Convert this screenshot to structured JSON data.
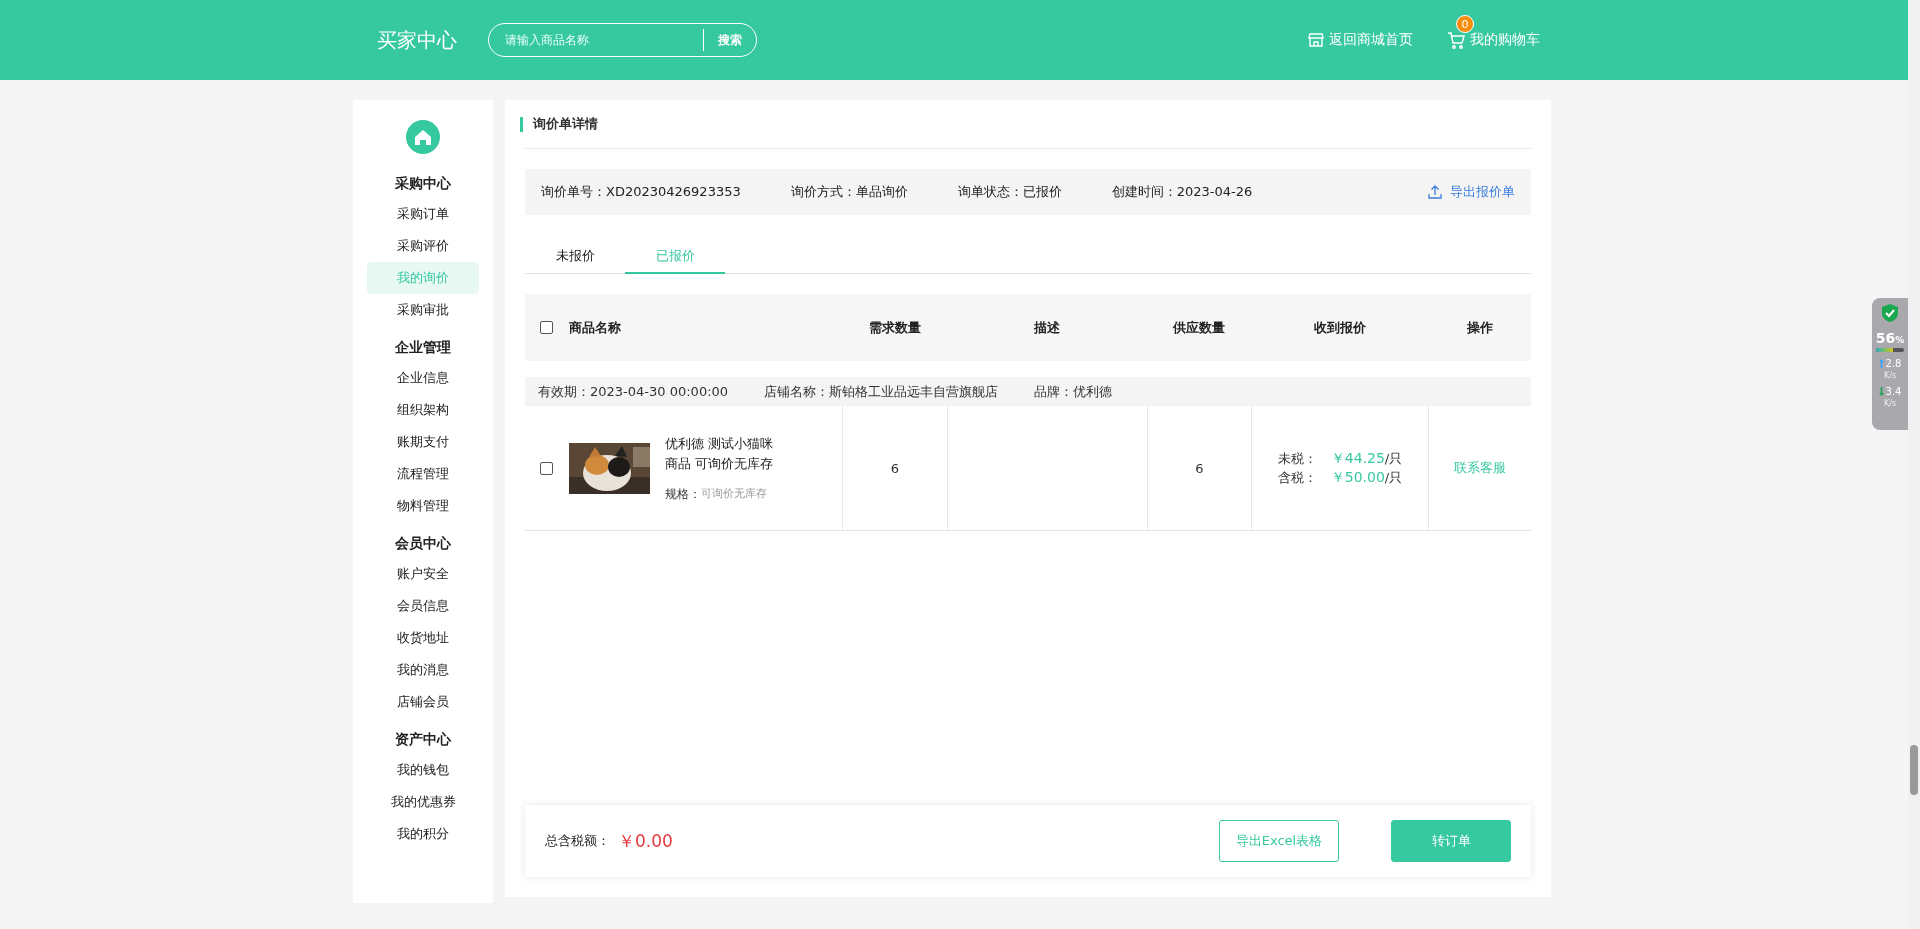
{
  "header": {
    "logo": "买家中心",
    "search": {
      "placeholder": "请输入商品名称",
      "button": "搜索"
    },
    "links": [
      {
        "kind": "home",
        "label": "返回商城首页"
      },
      {
        "kind": "cart",
        "label": "我的购物车",
        "badge": "0"
      }
    ]
  },
  "sidebar": {
    "groups": [
      {
        "title": "采购中心",
        "items": [
          {
            "label": "采购订单",
            "selected": false
          },
          {
            "label": "采购评价",
            "selected": false
          },
          {
            "label": "我的询价",
            "selected": true
          },
          {
            "label": "采购审批",
            "selected": false
          }
        ]
      },
      {
        "title": "企业管理",
        "items": [
          {
            "label": "企业信息",
            "selected": false
          },
          {
            "label": "组织架构",
            "selected": false
          },
          {
            "label": "账期支付",
            "selected": false
          },
          {
            "label": "流程管理",
            "selected": false
          },
          {
            "label": "物料管理",
            "selected": false
          }
        ]
      },
      {
        "title": "会员中心",
        "items": [
          {
            "label": "账户安全",
            "selected": false
          },
          {
            "label": "会员信息",
            "selected": false
          },
          {
            "label": "收货地址",
            "selected": false
          },
          {
            "label": "我的消息",
            "selected": false
          },
          {
            "label": "店铺会员",
            "selected": false
          }
        ]
      },
      {
        "title": "资产中心",
        "items": [
          {
            "label": "我的钱包",
            "selected": false
          },
          {
            "label": "我的优惠券",
            "selected": false
          },
          {
            "label": "我的积分",
            "selected": false
          }
        ]
      }
    ]
  },
  "page_title": "询价单详情",
  "info": [
    {
      "label": "询价单号：",
      "value": "XD20230426923353"
    },
    {
      "label": "询价方式：",
      "value": "单品询价"
    },
    {
      "label": "询单状态：",
      "value": "已报价"
    },
    {
      "label": "创建时间：",
      "value": "2023-04-26"
    }
  ],
  "export_quote": "导出报价单",
  "tabs": [
    {
      "label": "未报价",
      "selected": false
    },
    {
      "label": "已报价",
      "selected": true
    }
  ],
  "table": {
    "select_all": {
      "checked": false
    },
    "columns": [
      "商品名称",
      "需求数量",
      "描述",
      "供应数量",
      "收到报价",
      "操作"
    ],
    "groups": [
      {
        "validity": "有效期：2023-04-30 00:00:00",
        "shop": "店铺名称：斯铂格工业品远丰自营旗舰店",
        "brand": "品牌：优利德",
        "rows": [
          {
            "checked": false,
            "image": {
              "kind": "picture"
            },
            "name": "优利德 测试小猫咪商品 可询价无库存",
            "spec_label": "规格：",
            "spec": "可询价无库存",
            "demand": "6",
            "description": "",
            "supply": "6",
            "prices": [
              {
                "label": "未税：",
                "amount": "￥44.25",
                "unit": "/只"
              },
              {
                "label": "含税：",
                "amount": "￥50.00",
                "unit": "/只"
              }
            ],
            "action": "联系客服"
          }
        ]
      }
    ]
  },
  "footer": {
    "total_label": "总含税额：",
    "total": "￥0.00",
    "buttons": [
      {
        "kind": "outline",
        "label": "导出Excel表格"
      },
      {
        "kind": "primary",
        "label": "转订单"
      }
    ]
  },
  "widget": {
    "score": "56",
    "unit": "%",
    "level": 0.62,
    "up": "2.8",
    "up_unit": "K/s",
    "down": "3.4",
    "down_unit": "K/s"
  }
}
